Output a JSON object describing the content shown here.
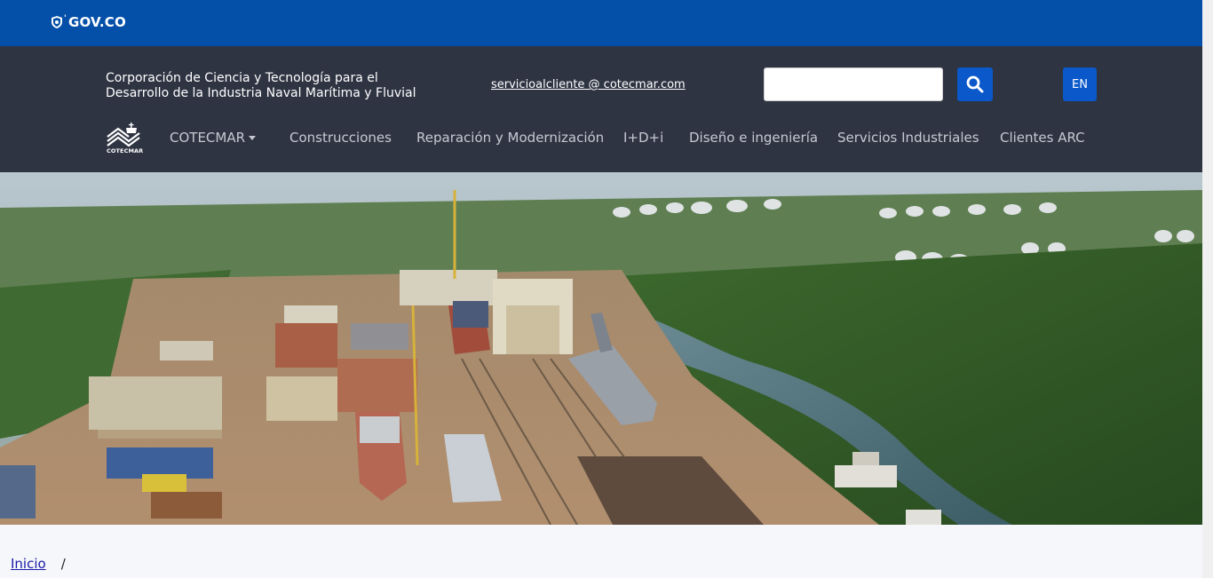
{
  "gov_bar": {
    "logo_text": "GOV.CO"
  },
  "header": {
    "org_name": "Corporación de Ciencia y Tecnología para el Desarrollo de la Industria Naval Marítima y Fluvial",
    "email": "servicioalcliente @ cotecmar.com",
    "search": {
      "placeholder": "",
      "value": ""
    },
    "language_button": "EN",
    "brand_logo_caption": "COTECMAR"
  },
  "nav": {
    "items": [
      {
        "label": "COTECMAR",
        "has_dropdown": true
      },
      {
        "label": "Construcciones"
      },
      {
        "label": "Reparación y Modernización"
      },
      {
        "label": "I+D+i"
      },
      {
        "label": "Diseño e ingeniería"
      },
      {
        "label": "Servicios Industriales"
      },
      {
        "label": "Clientes ARC"
      }
    ]
  },
  "breadcrumb": {
    "home": "Inicio",
    "separator": "/"
  },
  "colors": {
    "gov_bar": "#0450a8",
    "header_bg": "#2f3443",
    "accent_button": "#0a58ca"
  },
  "icons": {
    "search": "search-icon",
    "gov_shield": "shield-icon",
    "dropdown": "caret-down-icon"
  }
}
